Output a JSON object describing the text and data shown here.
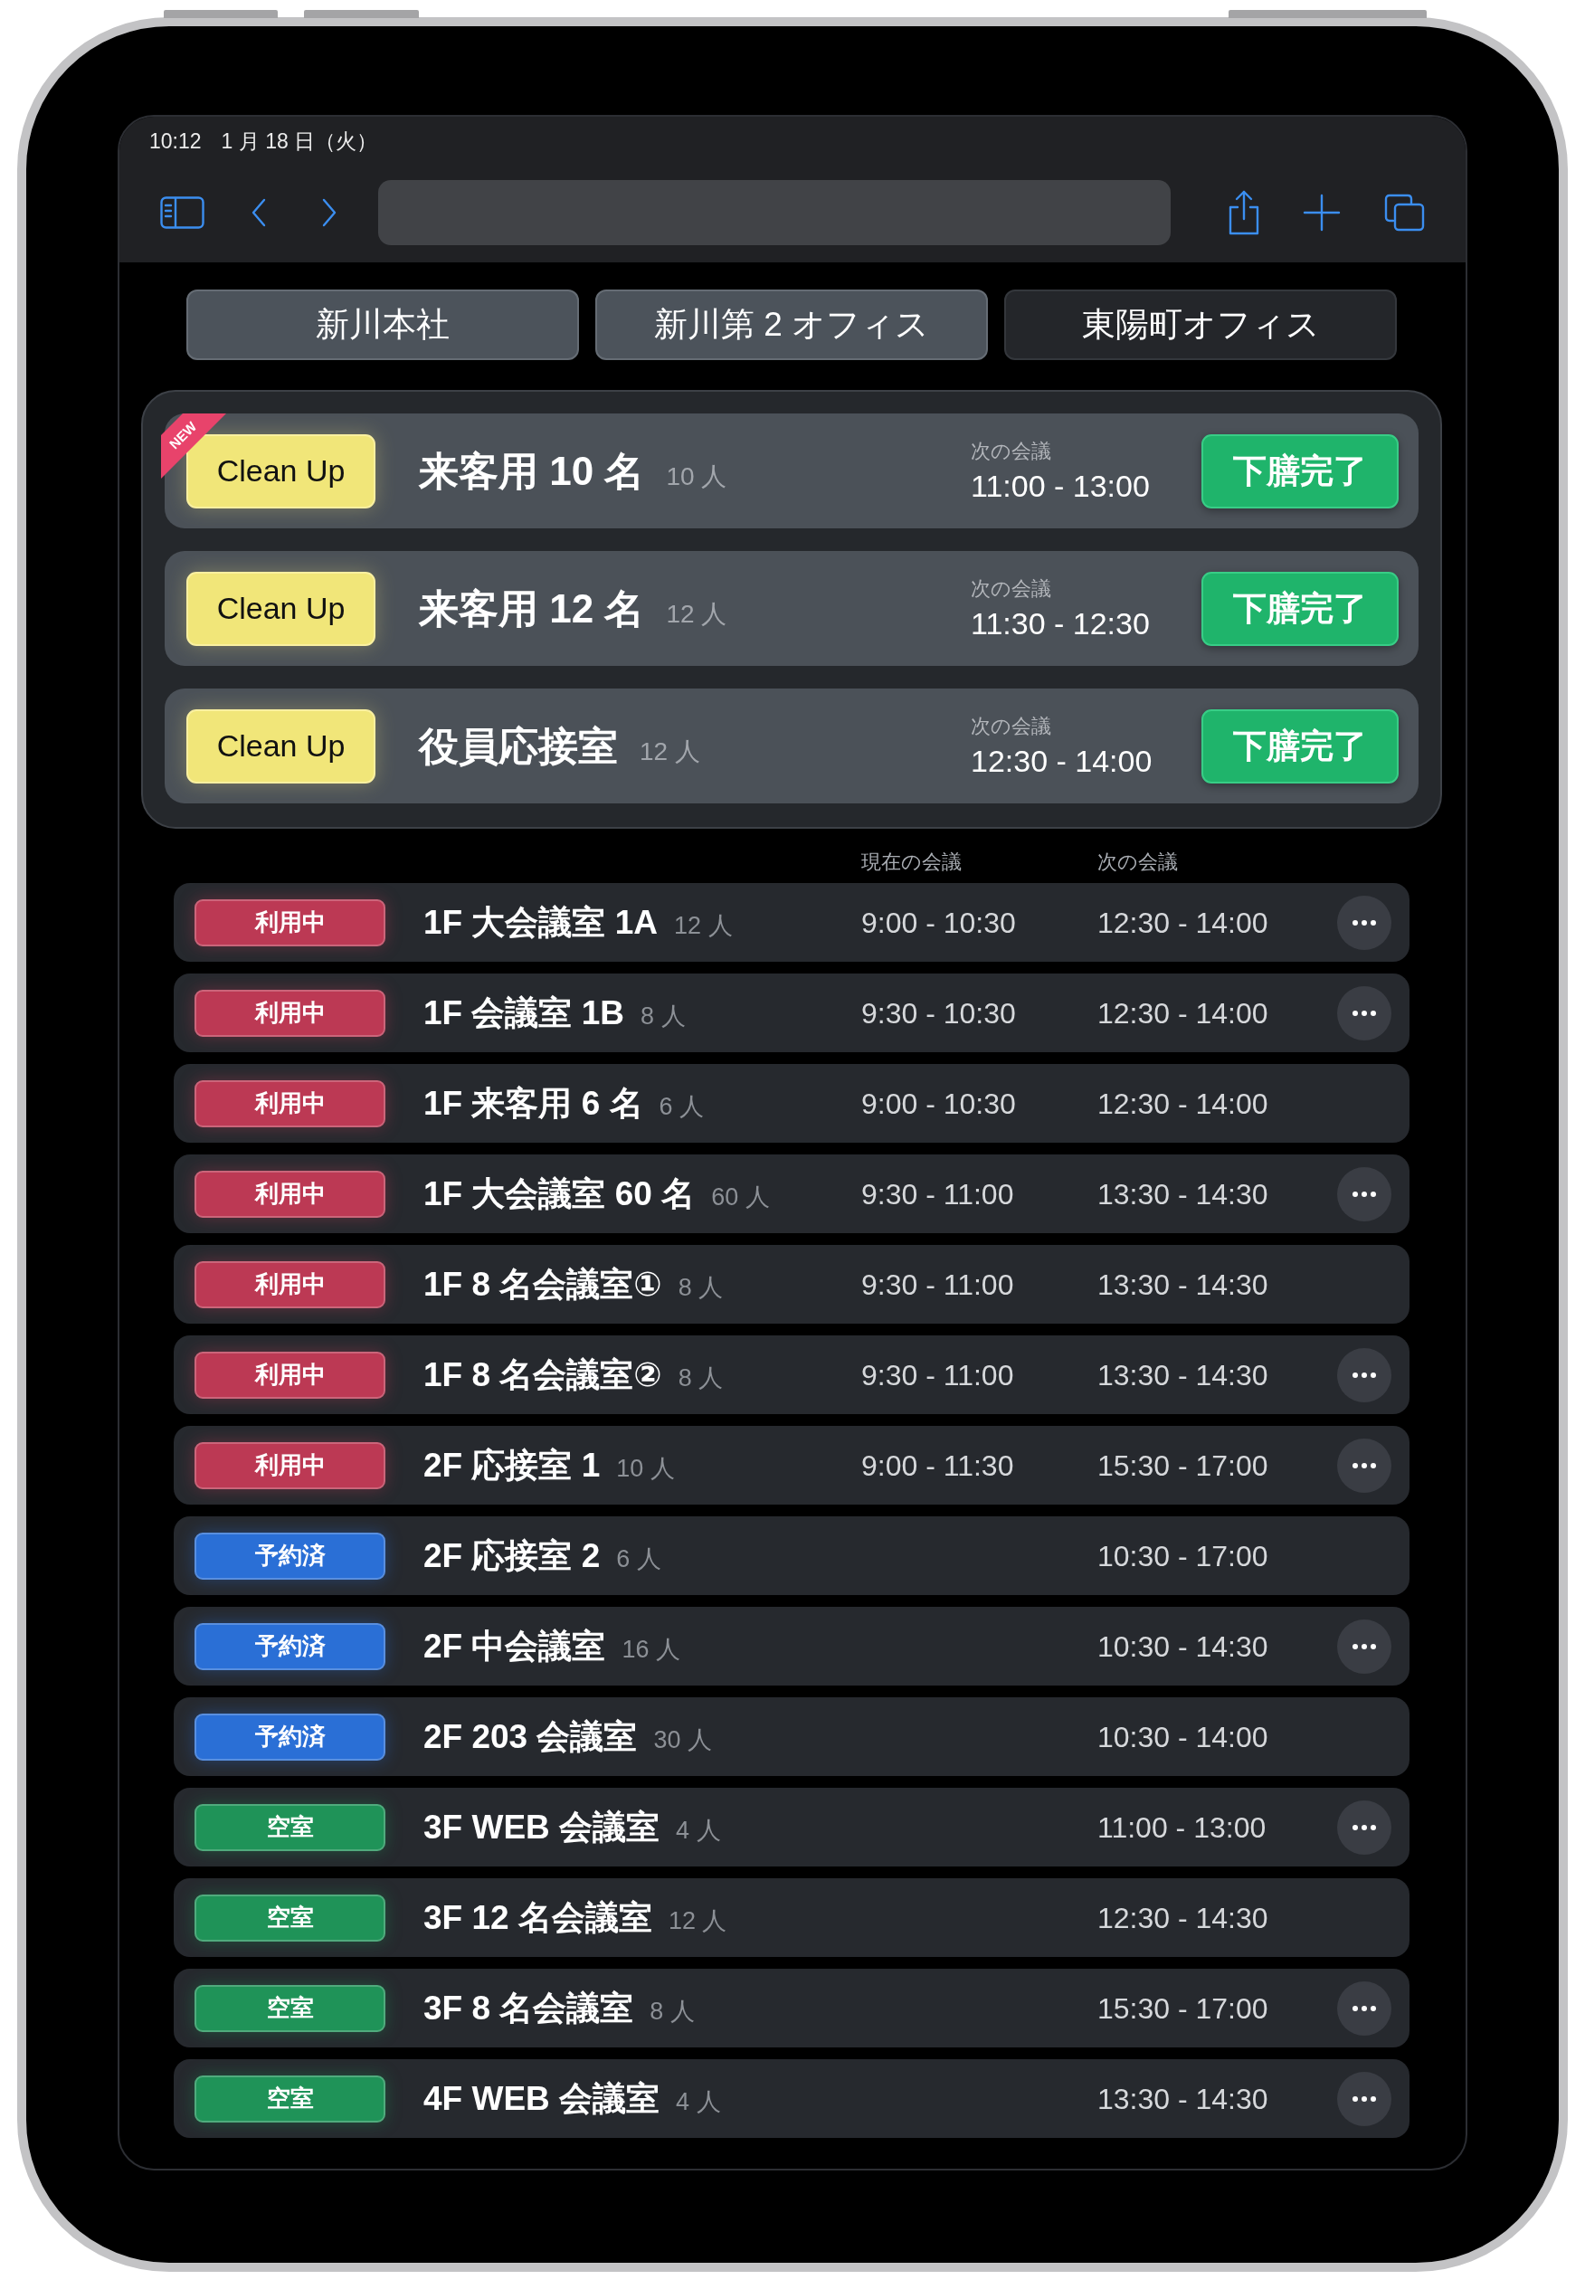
{
  "status_bar": {
    "time": "10:12",
    "date": "1 月 18 日（火）"
  },
  "office_tabs": [
    {
      "label": "新川本社",
      "selected": true
    },
    {
      "label": "新川第 2 オフィス",
      "selected": true
    },
    {
      "label": "東陽町オフィス",
      "selected": false
    }
  ],
  "cleanup": [
    {
      "ribbon": "NEW",
      "status": "Clean Up",
      "name": "来客用 10 名",
      "capacity": "10 人",
      "next_label": "次の会議",
      "next": "11:00 - 13:00",
      "action": "下膳完了"
    },
    {
      "status": "Clean Up",
      "name": "来客用 12 名",
      "capacity": "12 人",
      "next_label": "次の会議",
      "next": "11:30 - 12:30",
      "action": "下膳完了"
    },
    {
      "status": "Clean Up",
      "name": "役員応接室",
      "capacity": "12 人",
      "next_label": "次の会議",
      "next": "12:30 - 14:00",
      "action": "下膳完了"
    }
  ],
  "rooms": {
    "columns": [
      "現在の会議",
      "次の会議"
    ],
    "rows": [
      {
        "status": "利用中",
        "color": "#bc3954",
        "name": "1F 大会議室 1A",
        "capacity": "12 人",
        "current": "9:00 - 10:30",
        "next": "12:30 - 14:00",
        "menu": true
      },
      {
        "status": "利用中",
        "color": "#bc3954",
        "name": "1F 会議室 1B",
        "capacity": "8 人",
        "current": "9:30 - 10:30",
        "next": "12:30 - 14:00",
        "menu": true
      },
      {
        "status": "利用中",
        "color": "#bc3954",
        "name": "1F 来客用 6 名",
        "capacity": "6 人",
        "current": "9:00 - 10:30",
        "next": "12:30 - 14:00",
        "menu": false
      },
      {
        "status": "利用中",
        "color": "#bc3954",
        "name": "1F 大会議室 60 名",
        "capacity": "60 人",
        "current": "9:30 - 11:00",
        "next": "13:30 - 14:30",
        "menu": true
      },
      {
        "status": "利用中",
        "color": "#bc3954",
        "name": "1F 8 名会議室①",
        "capacity": "8 人",
        "current": "9:30 - 11:00",
        "next": "13:30 - 14:30",
        "menu": false
      },
      {
        "status": "利用中",
        "color": "#bc3954",
        "name": "1F 8 名会議室②",
        "capacity": "8 人",
        "current": "9:30 - 11:00",
        "next": "13:30 - 14:30",
        "menu": true
      },
      {
        "status": "利用中",
        "color": "#bc3954",
        "name": "2F 応接室 1",
        "capacity": "10 人",
        "current": "9:00 - 11:30",
        "next": "15:30 - 17:00",
        "menu": true
      },
      {
        "status": "予約済",
        "color": "#2a6fd6",
        "name": "2F 応接室 2",
        "capacity": "6 人",
        "next": "10:30 - 17:00",
        "menu": false
      },
      {
        "status": "予約済",
        "color": "#2a6fd6",
        "name": "2F 中会議室",
        "capacity": "16 人",
        "next": "10:30 - 14:30",
        "menu": true
      },
      {
        "status": "予約済",
        "color": "#2a6fd6",
        "name": "2F 203 会議室",
        "capacity": "30 人",
        "next": "10:30 - 14:00",
        "menu": false
      },
      {
        "status": "空室",
        "color": "#1f9358",
        "name": "3F WEB 会議室",
        "capacity": "4 人",
        "next": "11:00 - 13:00",
        "menu": true
      },
      {
        "status": "空室",
        "color": "#1f9358",
        "name": "3F 12 名会議室",
        "capacity": "12 人",
        "next": "12:30 - 14:30",
        "menu": false
      },
      {
        "status": "空室",
        "color": "#1f9358",
        "name": "3F 8 名会議室",
        "capacity": "8 人",
        "next": "15:30 - 17:00",
        "menu": true
      },
      {
        "status": "空室",
        "color": "#1f9358",
        "name": "4F WEB 会議室",
        "capacity": "4 人",
        "next": "13:30 - 14:30",
        "menu": true
      }
    ]
  }
}
